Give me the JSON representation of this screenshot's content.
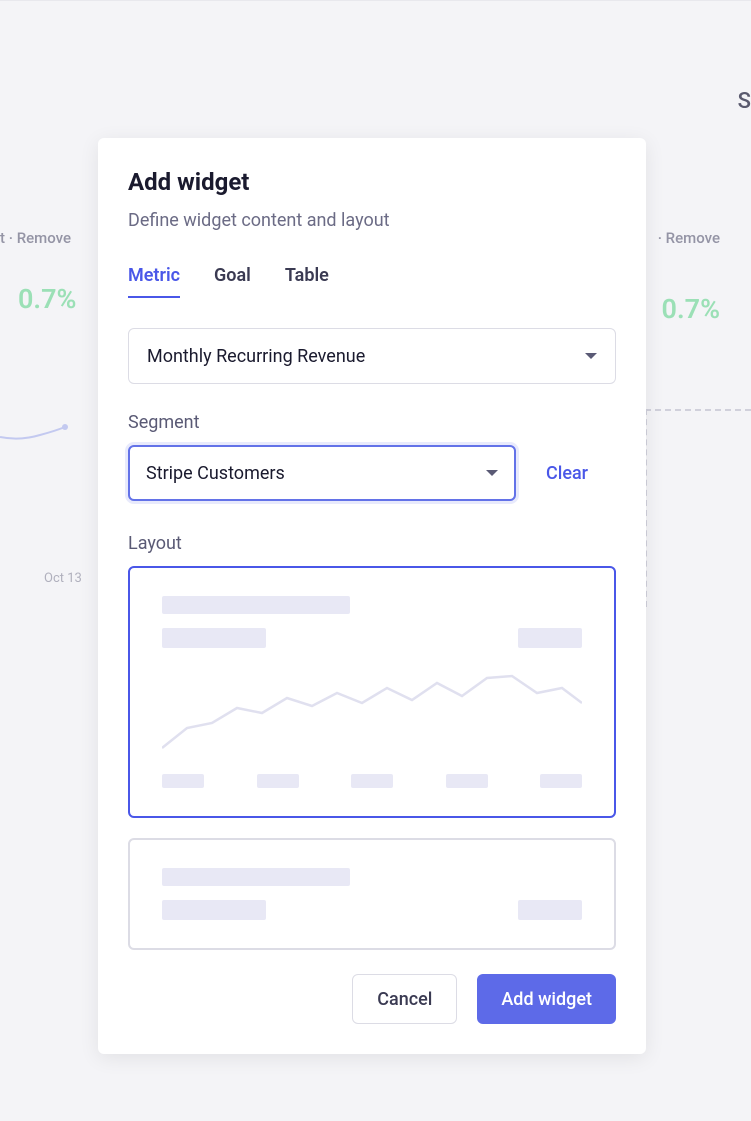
{
  "background": {
    "remove_left": "t  ·  Remove",
    "remove_right": "·  Remove",
    "pct_left": "0.7%",
    "pct_right": "0.7%",
    "s_right": "S",
    "date": "Oct 13"
  },
  "modal": {
    "title": "Add widget",
    "subtitle": "Define widget content and layout",
    "tabs": {
      "metric": "Metric",
      "goal": "Goal",
      "table": "Table"
    },
    "metric_select": "Monthly Recurring Revenue",
    "segment_label": "Segment",
    "segment_select": "Stripe Customers",
    "clear": "Clear",
    "layout_label": "Layout",
    "cancel": "Cancel",
    "submit": "Add widget"
  }
}
